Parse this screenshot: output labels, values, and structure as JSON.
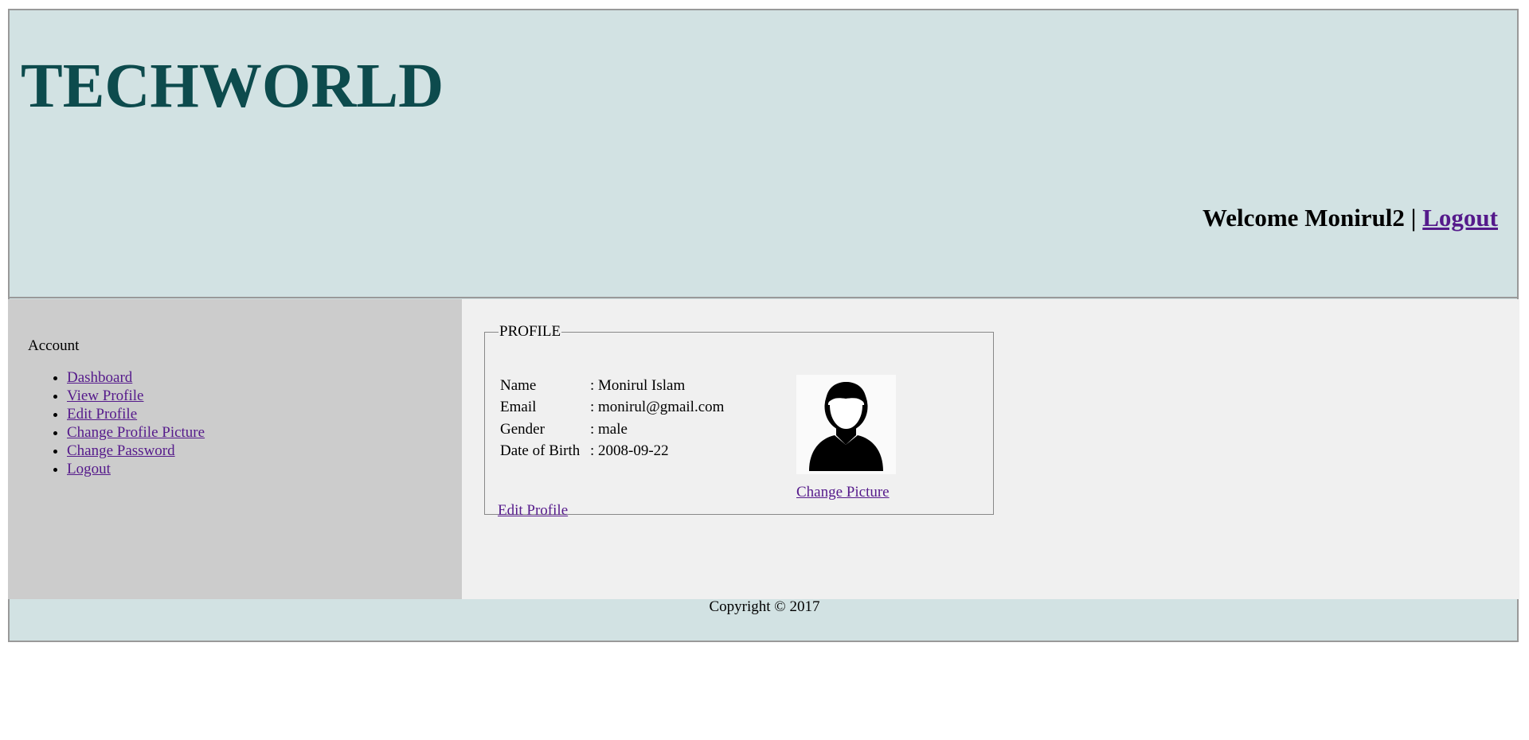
{
  "header": {
    "brand": "TECHWORLD",
    "welcome_text": "Welcome Monirul2 |",
    "logout_label": "Logout"
  },
  "sidebar": {
    "heading": "Account",
    "items": [
      {
        "label": "Dashboard"
      },
      {
        "label": "View Profile"
      },
      {
        "label": "Edit Profile"
      },
      {
        "label": "Change Profile Picture"
      },
      {
        "label": "Change Password"
      },
      {
        "label": "Logout"
      }
    ]
  },
  "profile": {
    "legend": "PROFILE",
    "fields": [
      {
        "label": "Name",
        "value": ": Monirul Islam"
      },
      {
        "label": "Email",
        "value": ": monirul@gmail.com"
      },
      {
        "label": "Gender",
        "value": ": male"
      },
      {
        "label": "Date of Birth",
        "value": ": 2008-09-22"
      }
    ],
    "avatar_icon": "user-silhouette-icon",
    "change_picture_label": "Change Picture",
    "edit_profile_label": "Edit Profile"
  },
  "footer": {
    "copyright": "Copyright © 2017"
  },
  "colors": {
    "header_bg": "#d2e2e3",
    "brand": "#0d4b4d",
    "sidebar_bg": "#cccccc",
    "main_bg": "#f0f0f0",
    "link": "#551a8b"
  }
}
